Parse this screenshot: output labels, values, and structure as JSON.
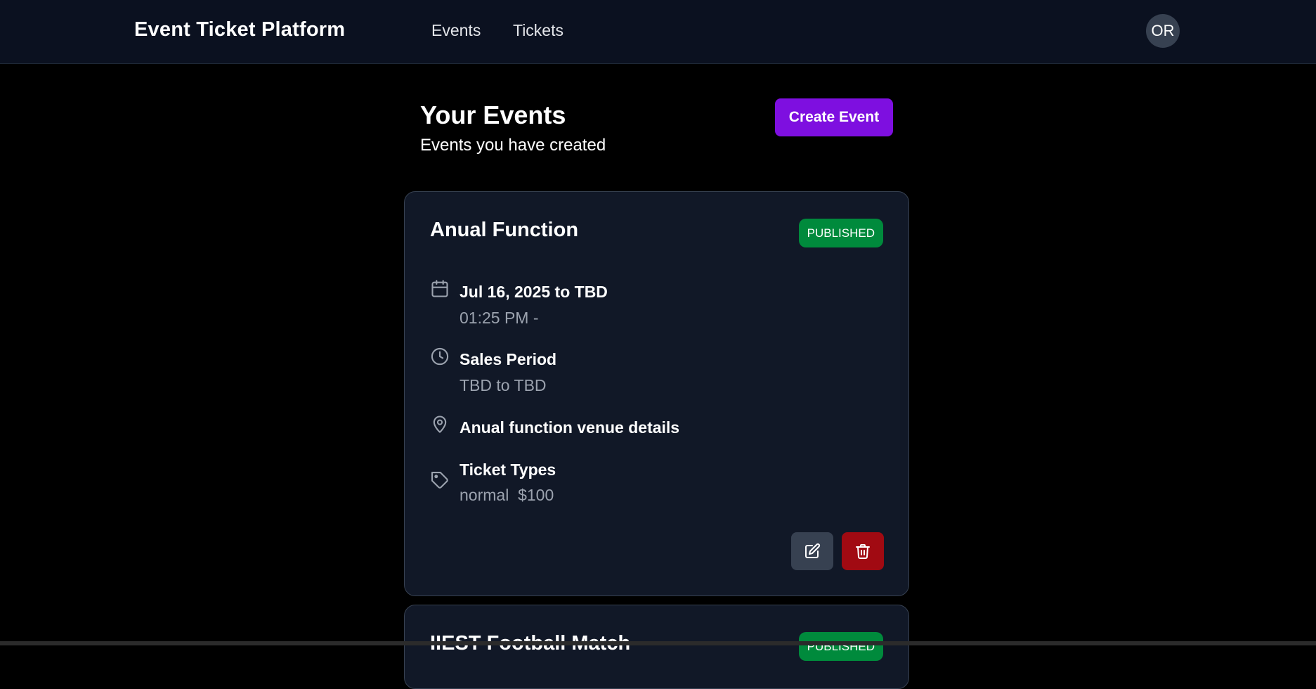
{
  "header": {
    "brand": "Event Ticket Platform",
    "nav": [
      {
        "label": "Events"
      },
      {
        "label": "Tickets"
      }
    ],
    "avatar_initials": "OR"
  },
  "page": {
    "title": "Your Events",
    "subtitle": "Events you have created",
    "create_button_label": "Create Event"
  },
  "colors": {
    "accent": "#7e0fe0",
    "published": "#008a3c",
    "delete": "#a10a12",
    "card_bg": "#111827"
  },
  "events": [
    {
      "name": "Anual Function",
      "status": "PUBLISHED",
      "date_range": "Jul 16, 2025 to TBD",
      "time_range": "01:25 PM -",
      "sales_period_label": "Sales Period",
      "sales_period": "TBD to TBD",
      "venue": "Anual function venue details",
      "ticket_types_label": "Ticket Types",
      "ticket_types": "normal  $100",
      "icons": [
        "calendar-icon",
        "clock-icon",
        "map-pin-icon",
        "tag-icon",
        "edit-icon",
        "trash-icon"
      ]
    },
    {
      "name": "IIEST Football Match",
      "status": "PUBLISHED"
    }
  ]
}
